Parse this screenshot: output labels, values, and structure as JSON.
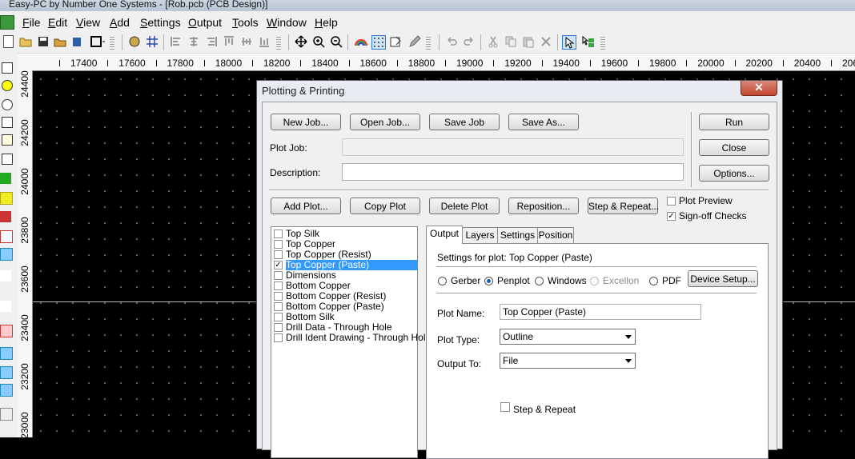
{
  "window": {
    "title": "Easy-PC by Number One Systems - [Rob.pcb (PCB Design)]"
  },
  "menu": [
    {
      "label": "File",
      "u": "F",
      "rest": "ile"
    },
    {
      "label": "Edit",
      "u": "E",
      "rest": "dit"
    },
    {
      "label": "View",
      "u": "V",
      "rest": "iew"
    },
    {
      "label": "Add",
      "u": "A",
      "rest": "dd"
    },
    {
      "label": "Settings",
      "u": "S",
      "rest": "ettings"
    },
    {
      "label": "Output",
      "u": "O",
      "rest": "utput"
    },
    {
      "label": "Tools",
      "u": "T",
      "rest": "ools"
    },
    {
      "label": "Window",
      "u": "W",
      "rest": "indow"
    },
    {
      "label": "Help",
      "u": "H",
      "rest": "elp"
    }
  ],
  "ruler": {
    "x_labels": [
      "17400",
      "17600",
      "17800",
      "18000",
      "18200",
      "18400",
      "18600",
      "18800",
      "19000",
      "19200",
      "19400",
      "19600",
      "19800",
      "20000",
      "20200",
      "20400",
      "206"
    ],
    "y_labels": [
      "24400",
      "24200",
      "24000",
      "23800",
      "23600",
      "23400",
      "23200",
      "23000"
    ]
  },
  "dialog": {
    "title": "Plotting & Printing",
    "close_glyph": "✕",
    "buttons": {
      "new_job": "New Job...",
      "open_job": "Open Job...",
      "save_job": "Save Job",
      "save_as": "Save As...",
      "run": "Run",
      "close": "Close",
      "options": "Options...",
      "add_plot": "Add Plot...",
      "copy_plot": "Copy Plot",
      "delete_plot": "Delete Plot",
      "reposition": "Reposition...",
      "step_repeat": "Step & Repeat...",
      "device_setup": "Device Setup..."
    },
    "plot_job_label": "Plot Job:",
    "plot_job_value": "",
    "description_label": "Description:",
    "description_value": "",
    "plot_preview": {
      "label": "Plot Preview",
      "checked": false
    },
    "signoff_checks": {
      "label": "Sign-off Checks",
      "checked": true
    },
    "plots": [
      {
        "name": "Top Silk",
        "checked": false,
        "selected": false
      },
      {
        "name": "Top Copper",
        "checked": false,
        "selected": false
      },
      {
        "name": "Top Copper (Resist)",
        "checked": false,
        "selected": false
      },
      {
        "name": "Top Copper (Paste)",
        "checked": true,
        "selected": true
      },
      {
        "name": "Dimensions",
        "checked": false,
        "selected": false
      },
      {
        "name": "Bottom Copper",
        "checked": false,
        "selected": false
      },
      {
        "name": "Bottom Copper (Resist)",
        "checked": false,
        "selected": false
      },
      {
        "name": "Bottom Copper (Paste)",
        "checked": false,
        "selected": false
      },
      {
        "name": "Bottom Silk",
        "checked": false,
        "selected": false
      },
      {
        "name": "Drill Data - Through Hole",
        "checked": false,
        "selected": false
      },
      {
        "name": "Drill Ident Drawing - Through Hole",
        "checked": false,
        "selected": false
      }
    ],
    "tabs": [
      "Output",
      "Layers",
      "Settings",
      "Position"
    ],
    "active_tab": "Output",
    "output": {
      "settings_for": "Settings for plot: Top Copper (Paste)",
      "formats": [
        {
          "label": "Gerber",
          "selected": false,
          "enabled": true
        },
        {
          "label": "Penplot",
          "selected": true,
          "enabled": true
        },
        {
          "label": "Windows",
          "selected": false,
          "enabled": true
        },
        {
          "label": "Excellon",
          "selected": false,
          "enabled": false
        },
        {
          "label": "PDF",
          "selected": false,
          "enabled": true
        }
      ],
      "plot_name_label": "Plot Name:",
      "plot_name_value": "Top Copper (Paste)",
      "plot_type_label": "Plot Type:",
      "plot_type_value": "Outline",
      "output_to_label": "Output To:",
      "output_to_value": "File",
      "step_repeat_label": "Step & Repeat",
      "step_repeat_checked": false
    }
  }
}
